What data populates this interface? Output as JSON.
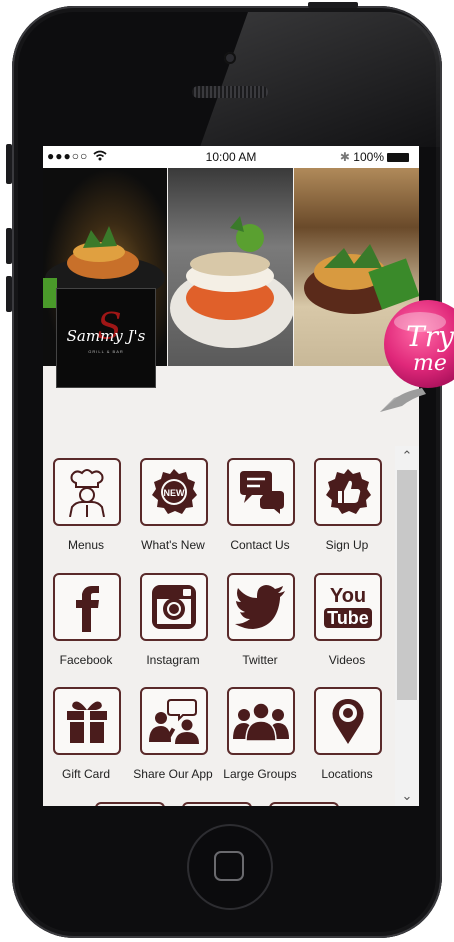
{
  "status_bar": {
    "signal": "●●●○○",
    "wifi_icon": "wifi-icon",
    "time": "10:00 AM",
    "bluetooth": "✱",
    "battery": "100%"
  },
  "banner": {
    "logo_text": "Sammy J's",
    "logo_subtext": "GRILL & BAR"
  },
  "try_me": {
    "line1": "Try",
    "line2": "me"
  },
  "menu": [
    {
      "label": "Menus",
      "icon": "chef-icon"
    },
    {
      "label": "What's New",
      "icon": "new-badge-icon"
    },
    {
      "label": "Contact Us",
      "icon": "chat-bubbles-icon"
    },
    {
      "label": "Sign Up",
      "icon": "thumbs-up-icon"
    },
    {
      "label": "Facebook",
      "icon": "facebook-icon"
    },
    {
      "label": "Instagram",
      "icon": "instagram-icon"
    },
    {
      "label": "Twitter",
      "icon": "twitter-icon"
    },
    {
      "label": "Videos",
      "icon": "youtube-icon"
    },
    {
      "label": "Gift Card",
      "icon": "gift-icon"
    },
    {
      "label": "Share Our App",
      "icon": "share-people-icon"
    },
    {
      "label": "Large Groups",
      "icon": "group-icon"
    },
    {
      "label": "Locations",
      "icon": "map-pin-icon"
    }
  ],
  "youtube": {
    "top": "You",
    "bottom": "Tube"
  },
  "new_badge": "NEW",
  "colors": {
    "icon": "#4a1c1c",
    "tile_border": "#5a2a2a",
    "try_me": "#e0287a"
  }
}
